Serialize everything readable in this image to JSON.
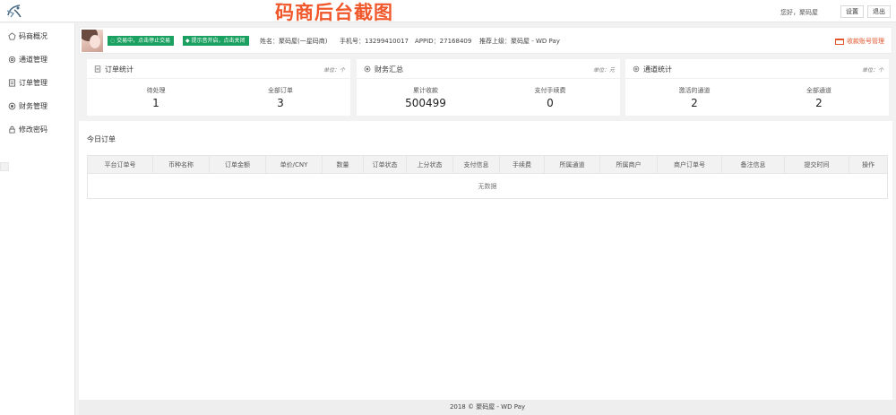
{
  "header": {
    "watermark": "码商后台截图",
    "greeting": "您好，聚码屋",
    "settings_label": "设置",
    "logout_label": "退出"
  },
  "sidebar": {
    "items": [
      {
        "label": "码商概况",
        "icon": "pentagon-icon"
      },
      {
        "label": "通道管理",
        "icon": "gear-icon"
      },
      {
        "label": "订单管理",
        "icon": "document-icon"
      },
      {
        "label": "财务管理",
        "icon": "circle-dot-icon"
      },
      {
        "label": "修改密码",
        "icon": "lock-icon"
      }
    ]
  },
  "profile": {
    "tag_trade": "交易中，点击停止交易",
    "tag_alert": "提示音开启，点击关闭",
    "name": "姓名：聚码屋(一星码商)",
    "phone": "手机号：13299410017",
    "appid": "APPID：27168409",
    "referrer": "推荐上级：聚码屋 - WD Pay",
    "manage_link": "收款账号管理",
    "colors": {
      "tag_green": "#1aa060",
      "accent": "#e2552c"
    }
  },
  "cards": [
    {
      "title": "订单统计",
      "icon": "document-icon",
      "unit": "单位：个",
      "stats": [
        {
          "label": "待处理",
          "value": "1"
        },
        {
          "label": "全部订单",
          "value": "3"
        }
      ]
    },
    {
      "title": "财务汇总",
      "icon": "circle-dot-icon",
      "unit": "单位：元",
      "stats": [
        {
          "label": "累计收款",
          "value": "500499"
        },
        {
          "label": "支付手续费",
          "value": "0"
        }
      ]
    },
    {
      "title": "通道统计",
      "icon": "gear-icon",
      "unit": "单位：个",
      "stats": [
        {
          "label": "激活的通道",
          "value": "2"
        },
        {
          "label": "全部通道",
          "value": "2"
        }
      ]
    }
  ],
  "orders": {
    "title": "今日订单",
    "columns": [
      "平台订单号",
      "币种名称",
      "订单金额",
      "单价/CNY",
      "数量",
      "订单状态",
      "上分状态",
      "支付信息",
      "手续费",
      "所属通道",
      "所属商户",
      "商户订单号",
      "备注信息",
      "提交时间",
      "操作"
    ],
    "empty_text": "无数据"
  },
  "footer": {
    "text": "2018 © 聚码屋 - WD Pay"
  }
}
